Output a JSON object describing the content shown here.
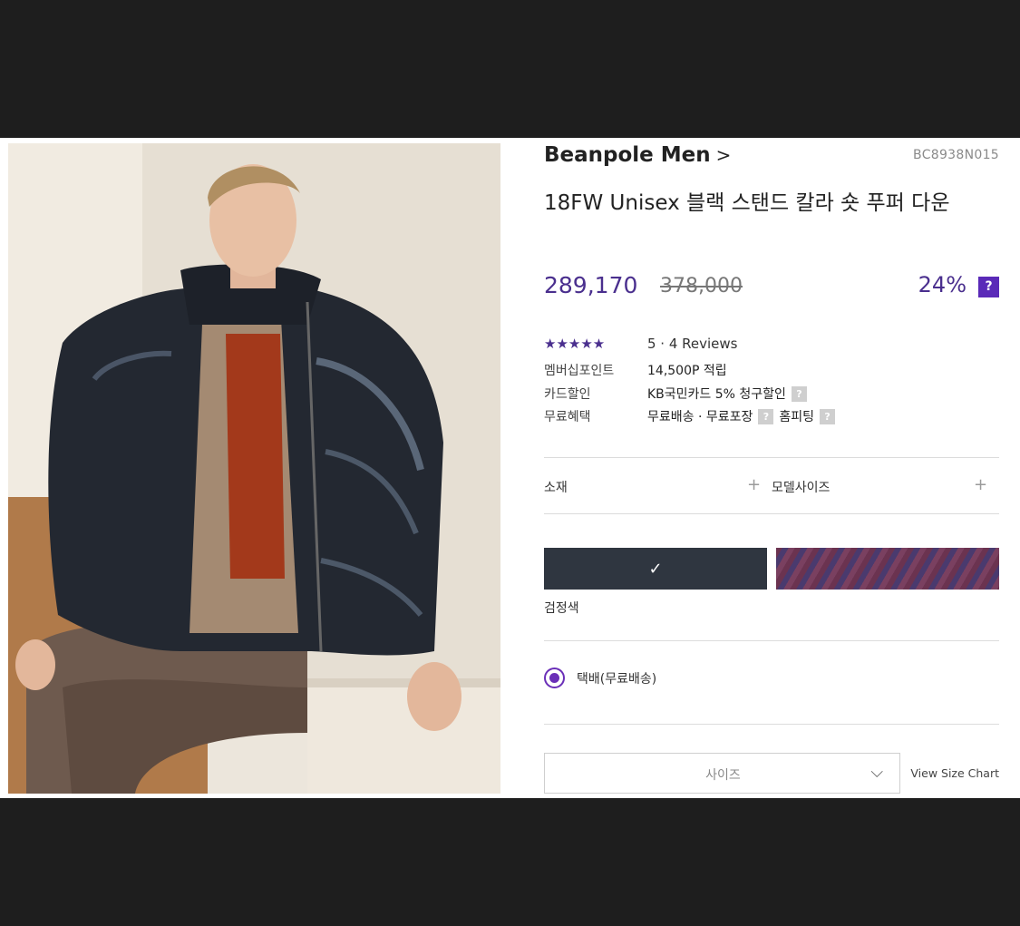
{
  "product": {
    "brand": "Beanpole Men",
    "brand_chevron": ">",
    "sku": "BC8938N015",
    "title": "18FW Unisex 블랙 스탠드 칼라 숏 푸퍼 다운",
    "price": "289,170",
    "original_price": "378,000",
    "discount": "24%",
    "discount_help": "?"
  },
  "rating": {
    "stars": "★★★★★",
    "text": "5 · 4 Reviews"
  },
  "benefits": [
    {
      "label": "멤버십포인트",
      "value": "14,500P 적립"
    },
    {
      "label": "카드할인",
      "value": "KB국민카드 5% 청구할인"
    },
    {
      "label": "무료혜택",
      "value": "무료배송 · 무료포장",
      "value2": "홈피팅"
    }
  ],
  "help_icon": "?",
  "accordion": {
    "material": "소재",
    "model_size": "모델사이즈",
    "plus": "+"
  },
  "colors": {
    "selected_check": "✓",
    "selected_name": "검정색",
    "swatch_colors": [
      "#2f3640",
      "#5b3458"
    ]
  },
  "delivery": {
    "option": "택배(무료배송)"
  },
  "size": {
    "placeholder": "사이즈",
    "chevron": "⌵",
    "chart_link": "View Size Chart"
  },
  "accent": "#4a2f8e"
}
